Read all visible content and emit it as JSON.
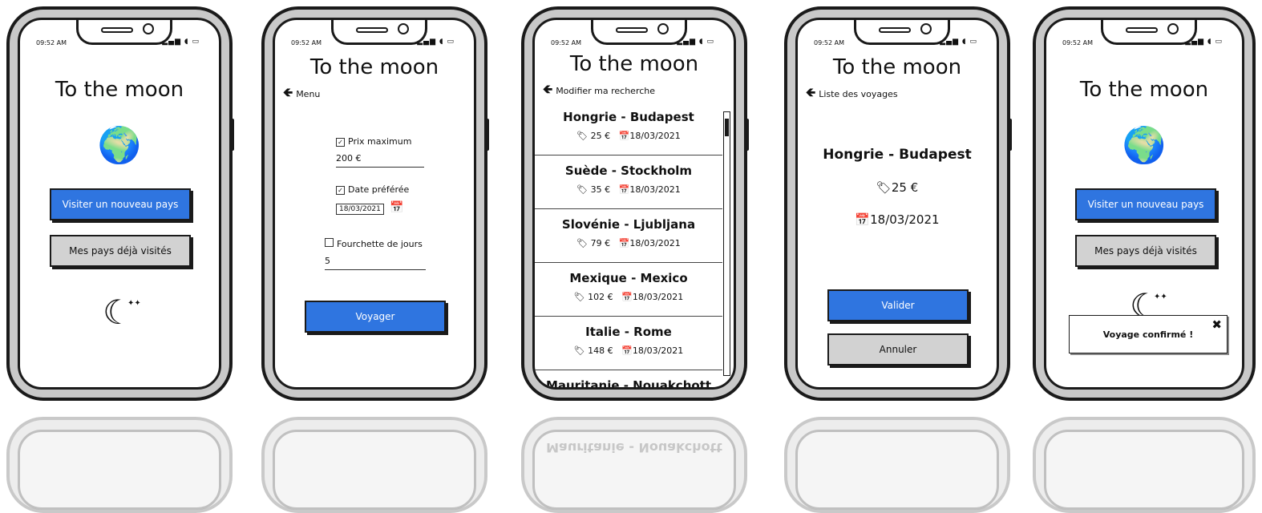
{
  "app": {
    "title": "To the moon"
  },
  "statusbar": {
    "time": "09:52 AM",
    "indicators": "▂▄▆ ◖ ▭"
  },
  "icons": {
    "globe": "🌍",
    "moon": "☾",
    "stars": "✦✦",
    "back_arrow": "🡸",
    "tag": "🏷",
    "calendar": "📅",
    "close": "✖",
    "checkbox_checked": "✓"
  },
  "screen1": {
    "visit_new_button": "Visiter un nouveau pays",
    "visited_button": "Mes pays déjà visités"
  },
  "screen2": {
    "back_label": "Menu",
    "max_price_label": "Prix maximum",
    "max_price_value": "200 €",
    "preferred_date_label": "Date préférée",
    "preferred_date_value": "18/03/2021",
    "day_range_label": "Fourchette de jours",
    "day_range_value": "5",
    "submit_button": "Voyager"
  },
  "screen3": {
    "back_label": "Modifier ma recherche",
    "trips": [
      {
        "name": "Hongrie - Budapest",
        "price": "25 €",
        "date": "18/03/2021"
      },
      {
        "name": "Suède - Stockholm",
        "price": "35 €",
        "date": "18/03/2021"
      },
      {
        "name": "Slovénie - Ljubljana",
        "price": "79 €",
        "date": "18/03/2021"
      },
      {
        "name": "Mexique - Mexico",
        "price": "102 €",
        "date": "18/03/2021"
      },
      {
        "name": "Italie - Rome",
        "price": "148 €",
        "date": "18/03/2021"
      },
      {
        "name": "Mauritanie - Nouakchott",
        "price": "",
        "date": ""
      }
    ]
  },
  "screen4": {
    "back_label": "Liste des voyages",
    "trip_name": "Hongrie - Budapest",
    "price": "25 €",
    "date": "18/03/2021",
    "confirm_button": "Valider",
    "cancel_button": "Annuler"
  },
  "screen5": {
    "visit_new_button": "Visiter un nouveau pays",
    "visited_button": "Mes pays déjà visités",
    "toast_message": "Voyage confirmé !"
  },
  "colors": {
    "primary": "#2f75e0",
    "secondary": "#d2d2d2",
    "frame": "#c9c9c9"
  }
}
